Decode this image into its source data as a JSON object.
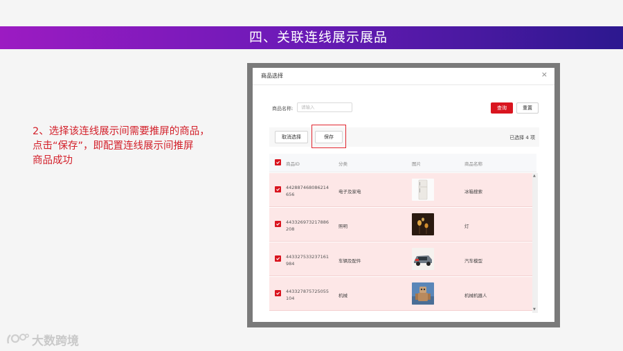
{
  "slide": {
    "title": "四、关联连线展示展品",
    "instruction": "2、选择该连线展示间需要推屏的商品，\n点击“保存”，即配置连线展示间推屏\n商品成功",
    "logo_text": "大数跨境"
  },
  "modal": {
    "title": "商品选择",
    "close": "×",
    "search": {
      "label": "商品名称:",
      "placeholder": "请输入"
    },
    "query_button": "查询",
    "reset_button": "重置",
    "deselect_button": "取消选择",
    "save_button": "保存",
    "selected_count": "已选择 4 项"
  },
  "table": {
    "columns": [
      "商品ID",
      "分类",
      "图片",
      "商品名称"
    ],
    "rows": [
      {
        "id": "442887468086214656",
        "category": "电子及家电",
        "image": "fridge-image",
        "name": "冰箱搜索"
      },
      {
        "id": "443326973217886208",
        "category": "照明",
        "image": "candle-lamp-image",
        "name": "灯"
      },
      {
        "id": "443327533237161984",
        "category": "车辆及配件",
        "image": "car-model-image",
        "name": "汽车模型"
      },
      {
        "id": "443327875725055104",
        "category": "机械",
        "image": "robot-image",
        "name": "机械机器人"
      }
    ]
  },
  "colors": {
    "accent": "#d9151f",
    "banner_start": "#9c1bc2",
    "banner_end": "#2c188f",
    "row_selected": "#fde7e7",
    "instruction": "#d3212b"
  }
}
